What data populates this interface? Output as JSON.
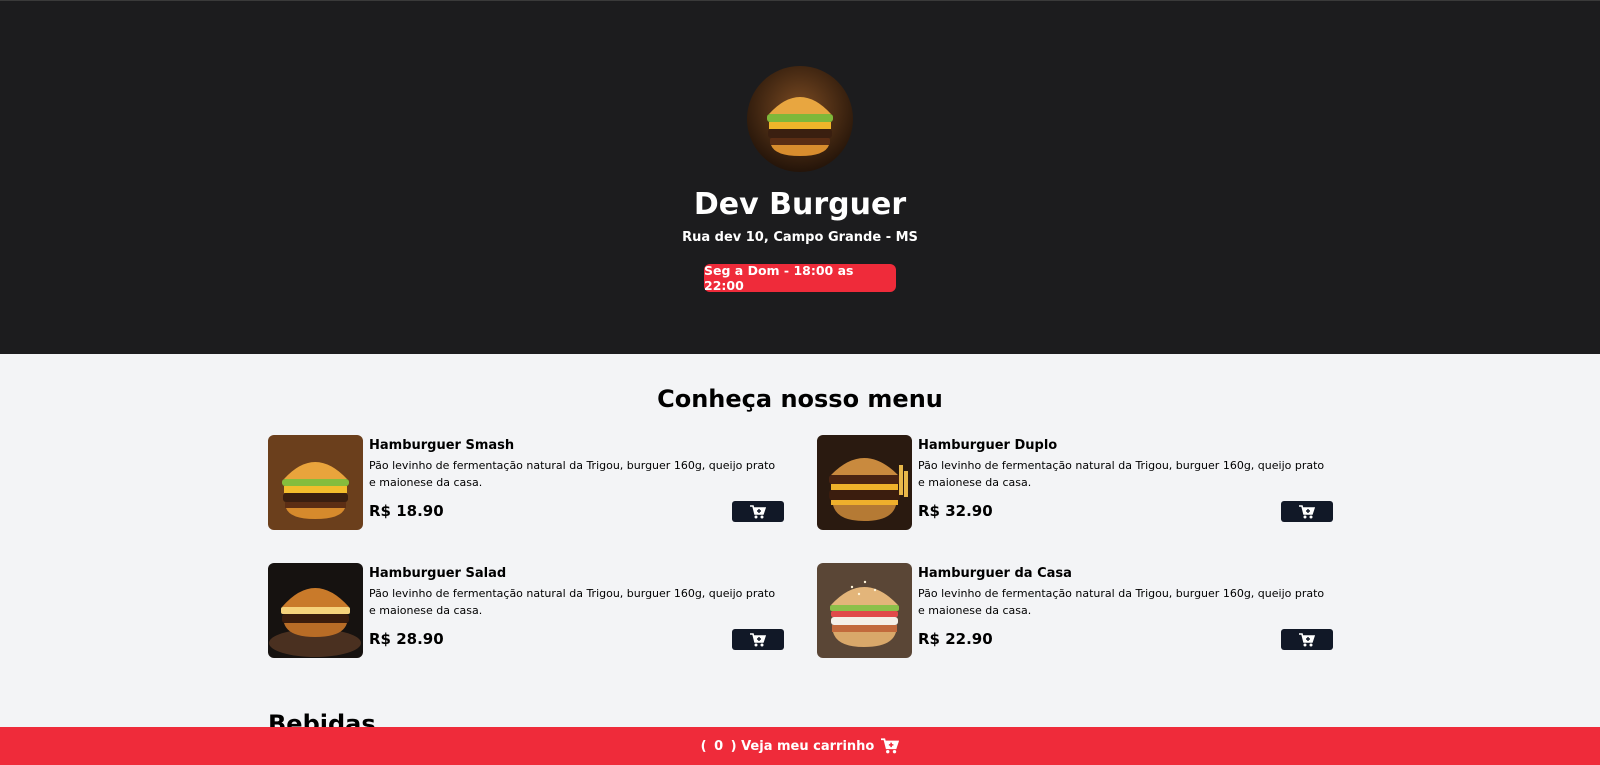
{
  "header": {
    "brand_name": "Dev Burguer",
    "address": "Rua dev 10, Campo Grande - MS",
    "opening_hours": "Seg a Dom - 18:00 as 22:00"
  },
  "menu": {
    "title": "Conheça nosso menu",
    "items": [
      {
        "name": "Hamburguer Smash",
        "description": "Pão levinho de fermentação natural da Trigou, burguer 160g, queijo prato e maionese da casa.",
        "price": "R$ 18.90"
      },
      {
        "name": "Hamburguer Duplo",
        "description": "Pão levinho de fermentação natural da Trigou, burguer 160g, queijo prato e maionese da casa.",
        "price": "R$ 32.90"
      },
      {
        "name": "Hamburguer Salad",
        "description": "Pão levinho de fermentação natural da Trigou, burguer 160g, queijo prato e maionese da casa.",
        "price": "R$ 28.90"
      },
      {
        "name": "Hamburguer da Casa",
        "description": "Pão levinho de fermentação natural da Trigou, burguer 160g, queijo prato e maionese da casa.",
        "price": "R$ 22.90"
      }
    ]
  },
  "drinks": {
    "title": "Bebidas"
  },
  "cart": {
    "open_paren": "(",
    "count": "0",
    "close_label": ") Veja meu carrinho"
  },
  "icons": {
    "add_to_cart": "cart-plus-icon",
    "cart": "cart-icon"
  },
  "colors": {
    "hero_bg": "#1c1c1e",
    "accent": "#ef2b3a",
    "button_dark": "#111827",
    "page_bg": "#f3f4f6"
  }
}
